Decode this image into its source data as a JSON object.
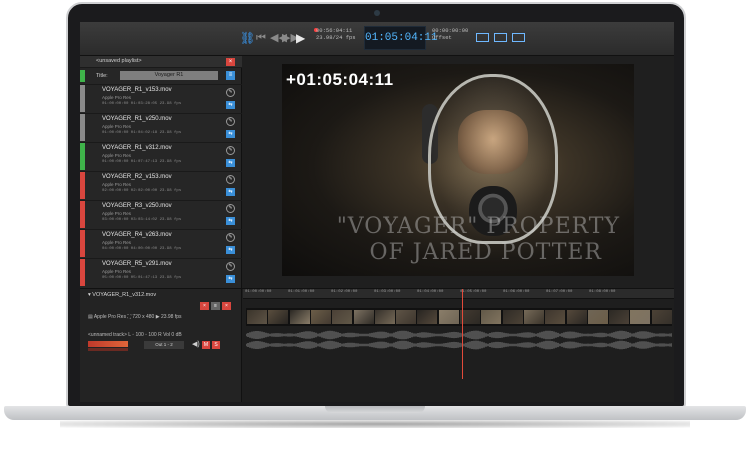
{
  "toolbar": {
    "link_icon": "link-icon",
    "tc_small_a_1": "00:56:04:11",
    "tc_small_a_2": "23.98/24 fps",
    "main_timecode": "01:05:04:11",
    "tc_small_b_1": "00:00:00:00",
    "tc_small_b_2": "Offset"
  },
  "playlist": {
    "header": "<unsaved playlist>",
    "close_label": "×",
    "title_label": "Title:",
    "title_value": "Voyager R1",
    "title_button": "≡",
    "clips": [
      {
        "name": "VOYAGER_R1_v153.mov",
        "codec": "Apple Pro Res",
        "meta": "01:00:00:00   01:03:28:05   23.98 fps",
        "flag": "#8a8a8a"
      },
      {
        "name": "VOYAGER_R1_v250.mov",
        "codec": "Apple Pro Res",
        "meta": "01:00:00:00   01:04:02:18   23.98 fps",
        "flag": "#8a8a8a"
      },
      {
        "name": "VOYAGER_R1_v312.mov",
        "codec": "Apple Pro Res",
        "meta": "01:00:00:00   01:07:47:13   23.98 fps",
        "flag": "#3fb34a"
      },
      {
        "name": "VOYAGER_R2_v153.mov",
        "codec": "Apple Pro Res",
        "meta": "02:00:00:00   02:02:00:00   23.98 fps",
        "flag": "#d9463e"
      },
      {
        "name": "VOYAGER_R3_v250.mov",
        "codec": "Apple Pro Res",
        "meta": "03:00:00:00   03:03:14:02   23.98 fps",
        "flag": "#d9463e"
      },
      {
        "name": "VOYAGER_R4_v263.mov",
        "codec": "Apple Pro Res",
        "meta": "04:00:00:00   04:00:00:00   23.98 fps",
        "flag": "#d9463e"
      },
      {
        "name": "VOYAGER_R5_v291.mov",
        "codec": "Apple Pro Res",
        "meta": "05:00:00:00   05:01:47:13   23.98 fps",
        "flag": "#d9463e"
      }
    ]
  },
  "viewer": {
    "timecode_overlay": "+01:05:04:11",
    "watermark_line1": "\"VOYAGER\" PROPERTY",
    "watermark_line2": "OF JARED POTTER"
  },
  "timeline": {
    "clip_name": "▾  VOYAGER_R1_v312.mov",
    "btn_x": "×",
    "btn_g": "≡",
    "btn_x2": "×",
    "codec_row": "▤    Apple Pro Res          ⛶  720 x 480          ▶  23.98 fps",
    "tracks_row": "<unnamed track>          L ◦ 100  ◦ 100  R    Vol       0 dB",
    "out_label": "Out 1 - 2",
    "speaker": "◀)",
    "mute": "M",
    "solo": "S",
    "ruler_ticks": [
      "01:00:00:00",
      "01:01:00:00",
      "01:02:00:00",
      "01:03:00:00",
      "01:04:00:00",
      "01:05:00:00",
      "01:06:00:00",
      "01:07:00:00",
      "01:08:00:00"
    ]
  }
}
